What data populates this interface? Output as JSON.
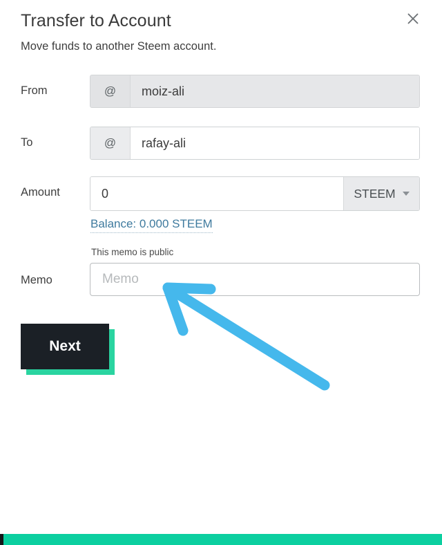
{
  "dialog": {
    "title": "Transfer to Account",
    "subtitle": "Move funds to another Steem account.",
    "close_label": "×"
  },
  "form": {
    "from": {
      "label": "From",
      "prefix": "@",
      "value": "moiz-ali",
      "disabled": true
    },
    "to": {
      "label": "To",
      "prefix": "@",
      "value": "rafay-ali",
      "placeholder": "",
      "disabled": false
    },
    "amount": {
      "label": "Amount",
      "value": "0",
      "placeholder": "0",
      "currency": "STEEM",
      "balance_link": "Balance: 0.000 STEEM"
    },
    "memo": {
      "label": "Memo",
      "hint": "This memo is public",
      "value": "",
      "placeholder": "Memo"
    }
  },
  "actions": {
    "next_label": "Next"
  },
  "colors": {
    "accent_teal": "#0ccfa0",
    "button_dark": "#1b2026",
    "annotation_blue": "#45b8ec",
    "link_blue": "#3e7a9e"
  },
  "annotation": {
    "arrow_color": "#45b8ec",
    "points_to": "memo-input"
  }
}
